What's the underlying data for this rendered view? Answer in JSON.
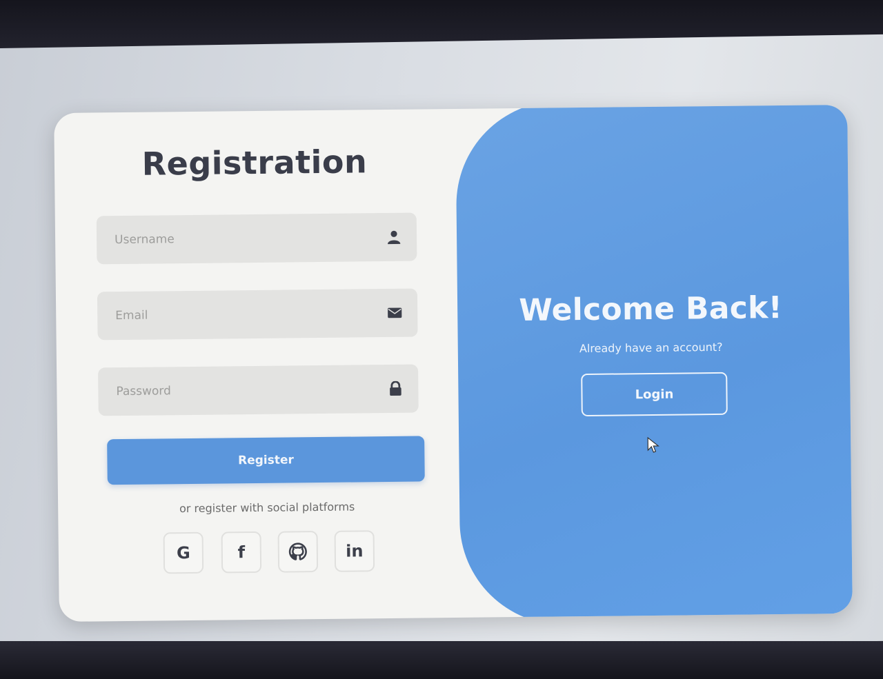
{
  "register_form": {
    "title": "Registration",
    "username": {
      "placeholder": "Username",
      "icon": "user-icon"
    },
    "email": {
      "placeholder": "Email",
      "icon": "envelope-icon"
    },
    "password": {
      "placeholder": "Password",
      "icon": "lock-icon"
    },
    "register_label": "Register",
    "social_text": "or register with social platforms",
    "socials": [
      {
        "label": "G",
        "icon": "google-icon"
      },
      {
        "label": "f",
        "icon": "facebook-icon"
      },
      {
        "label": "",
        "icon": "github-icon"
      },
      {
        "label": "in",
        "icon": "linkedin-icon"
      }
    ]
  },
  "login_panel": {
    "heading": "Welcome Back!",
    "subtext": "Already have an account?",
    "login_label": "Login"
  },
  "colors": {
    "accent": "#5b96dc",
    "panel": "#62a0e6",
    "card": "#f4f4f2",
    "field": "#e3e3e1",
    "title_text": "#3a3d4a"
  }
}
